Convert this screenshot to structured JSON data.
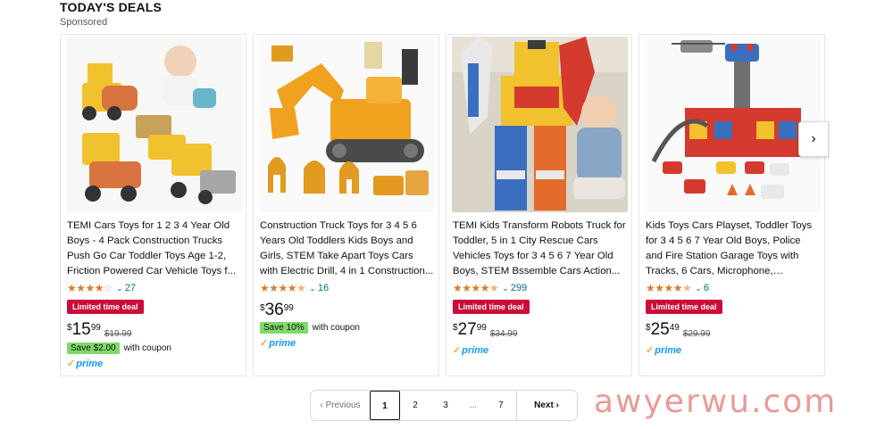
{
  "section": {
    "title": "TODAY'S DEALS",
    "subtitle": "Sponsored"
  },
  "products": [
    {
      "title": "TEMI Cars Toys for 1 2 3 4 Year Old Boys - 4 Pack Construction Trucks Push Go Car Toddler Toys Age 1-2, Friction Powered Car Vehicle Toys f...",
      "stars": "★★★★",
      "stars_dim": "☆",
      "rating_count": "27",
      "deal_badge": "Limited time deal",
      "price_symbol": "$",
      "price_whole": "15",
      "price_fraction": "99",
      "list_price": "$19.99",
      "coupon_badge": "Save $2.00",
      "coupon_text": "with coupon",
      "prime": "prime"
    },
    {
      "title": "Construction Truck Toys for 3 4 5 6 Years Old Toddlers Kids Boys and Girls, STEM Take Apart Toys Cars with Electric Drill, 4 in 1 Construction...",
      "stars": "★★★★",
      "stars_dim": "★",
      "rating_count": "16",
      "price_symbol": "$",
      "price_whole": "36",
      "price_fraction": "99",
      "coupon_badge": "Save 10%",
      "coupon_text": "with coupon",
      "prime": "prime"
    },
    {
      "title": "TEMI Kids Transform Robots Truck for Toddler, 5 in 1 City Rescue Cars Vehicles Toys for 3 4 5 6 7 Year Old Boys, STEM Bssemble Cars Action...",
      "stars": "★★★★",
      "stars_dim": "★",
      "rating_count": "299",
      "deal_badge": "Limited time deal",
      "price_symbol": "$",
      "price_whole": "27",
      "price_fraction": "99",
      "list_price": "$34.99",
      "prime": "prime"
    },
    {
      "title": "Kids Toys Cars Playset, Toddler Toys for 3 4 5 6 7 Year Old Boys, Police and Fire Station Garage Toys with Tracks, 6 Cars, Microphone, Stickers,...",
      "stars": "★★★★",
      "stars_dim": "★",
      "rating_count": "6",
      "deal_badge": "Limited time deal",
      "price_symbol": "$",
      "price_whole": "25",
      "price_fraction": "49",
      "list_price": "$29.99",
      "prime": "prime"
    }
  ],
  "carousel": {
    "next_icon": "›",
    "next_icon_name": "chevron-right-icon"
  },
  "pagination": {
    "previous": "Previous",
    "pages": [
      "1",
      "2",
      "3"
    ],
    "ellipsis": "...",
    "last_page": "7",
    "next": "Next",
    "current": "1"
  },
  "watermark": "awyerwu.com",
  "colors": {
    "deal_red": "#cc0c39",
    "coupon_green": "#7fda69",
    "star": "#de7921",
    "link": "#007185",
    "prime_blue": "#1399ff"
  }
}
